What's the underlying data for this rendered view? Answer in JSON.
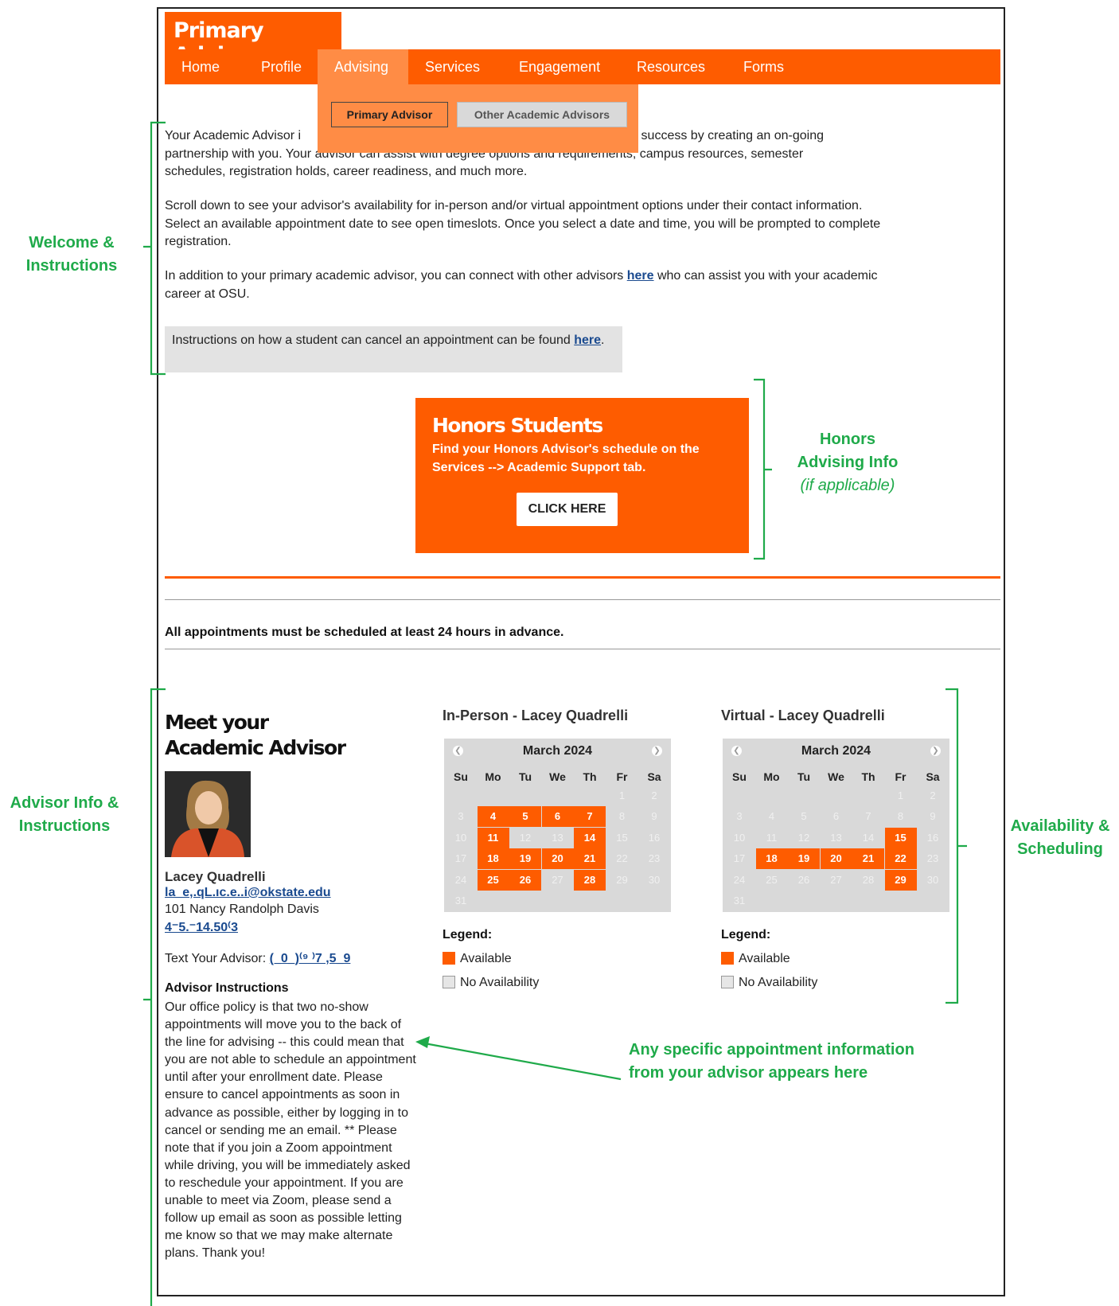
{
  "brand": {
    "title": "Primary Advisor"
  },
  "nav": {
    "items": [
      "Home",
      "Profile",
      "Advising",
      "Services",
      "Engagement",
      "Resources",
      "Forms"
    ],
    "active": "Advising"
  },
  "submenu": {
    "primary_label": "Primary Advisor",
    "other_label": "Other Academic Advisors"
  },
  "welcome": {
    "para1_line1_start": "Your Academic Advisor i",
    "para1_line1_end": "udent success by creating an on-going",
    "para1_line2": "partnership with you. Your advisor can assist with degree options and requirements, campus resources, semester",
    "para1_line3": "schedules, registration holds, career readiness, and much more.",
    "para2": "Scroll down to see your advisor's availability for in-person and/or virtual appointment options under their contact information. Select an available appointment date to see open timeslots. Once you select a date and time, you will be prompted to complete registration.",
    "para3_before": "In addition to your primary academic advisor, you can connect with other advisors ",
    "para3_link": "here",
    "para3_after": " who can assist you with your academic career at OSU.",
    "cancel_text": "Instructions on how a student can cancel an appointment can be found ",
    "cancel_link": "here",
    "cancel_end": "."
  },
  "honors": {
    "title": "Honors Students",
    "text": "Find your Honors Advisor's schedule on the Services --> Academic Support tab.",
    "button": "CLICK HERE"
  },
  "notice": "All appointments must be scheduled at least 24 hours in advance.",
  "advisor": {
    "heading_line1": "Meet your",
    "heading_line2": "Academic Advisor",
    "name": "Lacey Quadrelli",
    "email": "la_e,.qL.ıc.e..i@okstate.edu",
    "office": "101 Nancy Randolph Davis",
    "phone": "4⁻5.⁻14.50⁽3",
    "text_label": "Text Your Advisor: ",
    "text_number": "(_0_)⁽⁹ ⁾7  ,5_9",
    "instructions_title": "Advisor Instructions",
    "instructions": "Our office policy is that two no-show appointments will move you to the back of the line for advising -- this could mean that you are not able to schedule an appointment until after your enrollment date. Please ensure to cancel appointments as soon in advance as possible, either by logging in to cancel or sending me an email. ** Please note that if you join a Zoom appointment while driving, you will be immediately asked to reschedule your appointment. If you are unable to meet via Zoom, please send a follow up email as soon as possible letting me know so that we may make alternate plans. Thank you!"
  },
  "calendars": [
    {
      "title": "In-Person - Lacey Quadrelli",
      "month": "March 2024",
      "available": [
        4,
        5,
        6,
        7,
        11,
        14,
        18,
        19,
        20,
        21,
        25,
        26,
        28
      ]
    },
    {
      "title": "Virtual - Lacey Quadrelli",
      "month": "March 2024",
      "available": [
        15,
        18,
        19,
        20,
        21,
        22,
        29
      ]
    }
  ],
  "weekdays": [
    "Su",
    "Mo",
    "Tu",
    "We",
    "Th",
    "Fr",
    "Sa"
  ],
  "legend": {
    "title": "Legend:",
    "available": "Available",
    "none": "No Availability"
  },
  "annotations": {
    "welcome_line1": "Welcome &",
    "welcome_line2": "Instructions",
    "honors_line1": "Honors",
    "honors_line2": "Advising Info",
    "honors_line3": "(if applicable)",
    "advisor_line1": "Advisor Info &",
    "advisor_line2": "Instructions",
    "availability_line1": "Availability &",
    "availability_line2": "Scheduling",
    "specific_line1": "Any specific appointment information",
    "specific_line2": "from your advisor appears here"
  },
  "colors": {
    "brand_orange": "#fe5c00",
    "submenu_orange": "#ff8c45",
    "annotation_green": "#1faa4a",
    "link_blue": "#1a4a8f"
  }
}
